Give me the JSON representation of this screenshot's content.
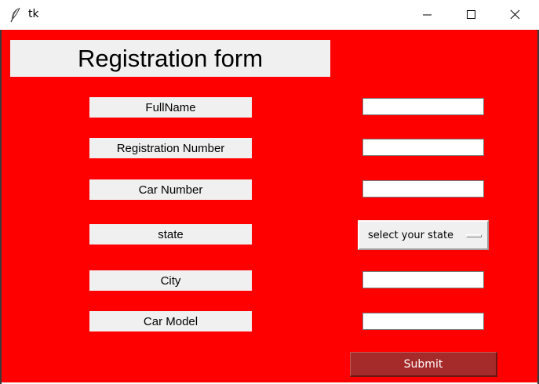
{
  "window": {
    "title": "tk",
    "icon": "feather-icon",
    "controls": [
      "minimize-icon",
      "maximize-icon",
      "close-icon"
    ]
  },
  "colors": {
    "background": "#ff0000",
    "label_bg": "#f0f0f0",
    "submit_bg": "#a52a2a",
    "submit_text": "#ffffff"
  },
  "form": {
    "heading": "Registration form",
    "fields": [
      {
        "label": "FullName",
        "value": ""
      },
      {
        "label": "Registration Number",
        "value": ""
      },
      {
        "label": "Car Number",
        "value": ""
      },
      {
        "label": "state",
        "selected": "select your state"
      },
      {
        "label": "City",
        "value": ""
      },
      {
        "label": "Car Model",
        "value": ""
      }
    ],
    "submit_label": "Submit"
  }
}
